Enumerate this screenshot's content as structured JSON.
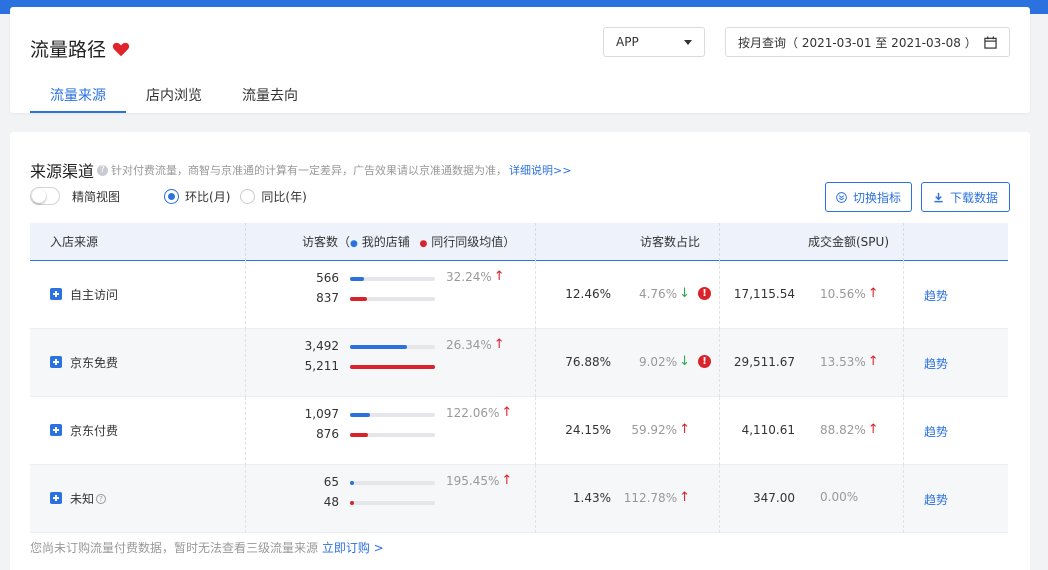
{
  "header": {
    "title": "流量路径",
    "platform": "APP",
    "date_range": "按月查询（ 2021-03-01 至 2021-03-08 ）"
  },
  "tabs": [
    {
      "label": "流量来源",
      "active": true
    },
    {
      "label": "店内浏览",
      "active": false
    },
    {
      "label": "流量去向",
      "active": false
    }
  ],
  "section": {
    "title": "来源渠道",
    "note": "针对付费流量，商智与京准通的计算有一定差异，广告效果请以京准通数据为准，",
    "link": "详细说明>>",
    "simple_view_label": "精简视图",
    "radio_mom": "环比(月)",
    "radio_yoy": "同比(年)",
    "switch_button": "切换指标",
    "download_button": "下载数据"
  },
  "table": {
    "headers": {
      "source": "入店来源",
      "visitors": "访客数（",
      "my_store": "我的店铺",
      "peer": "同行同级均值",
      "visitors_close": "）",
      "share": "访客数占比",
      "sales": "成交金额(SPU)"
    },
    "rows": [
      {
        "name": "自主访问",
        "mine": "566",
        "peer": "837",
        "mine_ratio": 0.16,
        "peer_ratio": 0.2,
        "visitor_change": "32.24%",
        "visitor_dir": "up",
        "share": "12.46%",
        "share_change": "4.76%",
        "share_dir": "down",
        "warn": true,
        "sales": "17,115.54",
        "sales_change": "10.56%",
        "sales_dir": "up",
        "trend": "趋势",
        "help": false
      },
      {
        "name": "京东免费",
        "mine": "3,492",
        "peer": "5,211",
        "mine_ratio": 0.67,
        "peer_ratio": 1.0,
        "visitor_change": "26.34%",
        "visitor_dir": "up",
        "share": "76.88%",
        "share_change": "9.02%",
        "share_dir": "down",
        "warn": true,
        "sales": "29,511.67",
        "sales_change": "13.53%",
        "sales_dir": "up",
        "trend": "趋势",
        "help": false
      },
      {
        "name": "京东付费",
        "mine": "1,097",
        "peer": "876",
        "mine_ratio": 0.24,
        "peer_ratio": 0.21,
        "visitor_change": "122.06%",
        "visitor_dir": "up",
        "share": "24.15%",
        "share_change": "59.92%",
        "share_dir": "up",
        "warn": false,
        "sales": "4,110.61",
        "sales_change": "88.82%",
        "sales_dir": "up",
        "trend": "趋势",
        "help": false
      },
      {
        "name": "未知",
        "mine": "65",
        "peer": "48",
        "mine_ratio": 0.05,
        "peer_ratio": 0.05,
        "visitor_change": "195.45%",
        "visitor_dir": "up",
        "share": "1.43%",
        "share_change": "112.78%",
        "share_dir": "up",
        "warn": false,
        "sales": "347.00",
        "sales_change": "0.00%",
        "sales_dir": "none",
        "trend": "趋势",
        "help": true
      }
    ]
  },
  "footer": {
    "text": "您尚未订购流量付费数据，暂时无法查看三级流量来源",
    "link": "立即订购 >"
  },
  "colors": {
    "accent": "#2b72e0",
    "mine_bar": "#2b72e0",
    "peer_bar": "#d9232a",
    "up": "#d9232a",
    "down": "#2aa94a"
  }
}
